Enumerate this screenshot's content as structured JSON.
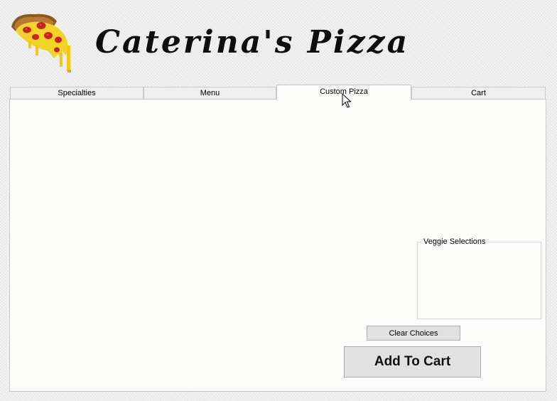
{
  "app": {
    "title": "Caterina's Pizza",
    "logo_icon": "pizza-slice-icon"
  },
  "tabs": [
    {
      "label": "Specialties",
      "active": false
    },
    {
      "label": "Menu",
      "active": false
    },
    {
      "label": "Custom Pizza",
      "active": true
    },
    {
      "label": "Cart",
      "active": false
    }
  ],
  "custom_pizza": {
    "veggie_group_label": "Veggie Selections",
    "clear_button_label": "Clear Choices",
    "add_to_cart_label": "Add To Cart"
  },
  "colors": {
    "background": "#ececec",
    "panel": "#fcfcfb",
    "button_face": "#e1e1e1",
    "border": "#adadad"
  },
  "cursor": {
    "icon": "mouse-pointer-icon",
    "hover_target": "tab-custom-pizza"
  }
}
